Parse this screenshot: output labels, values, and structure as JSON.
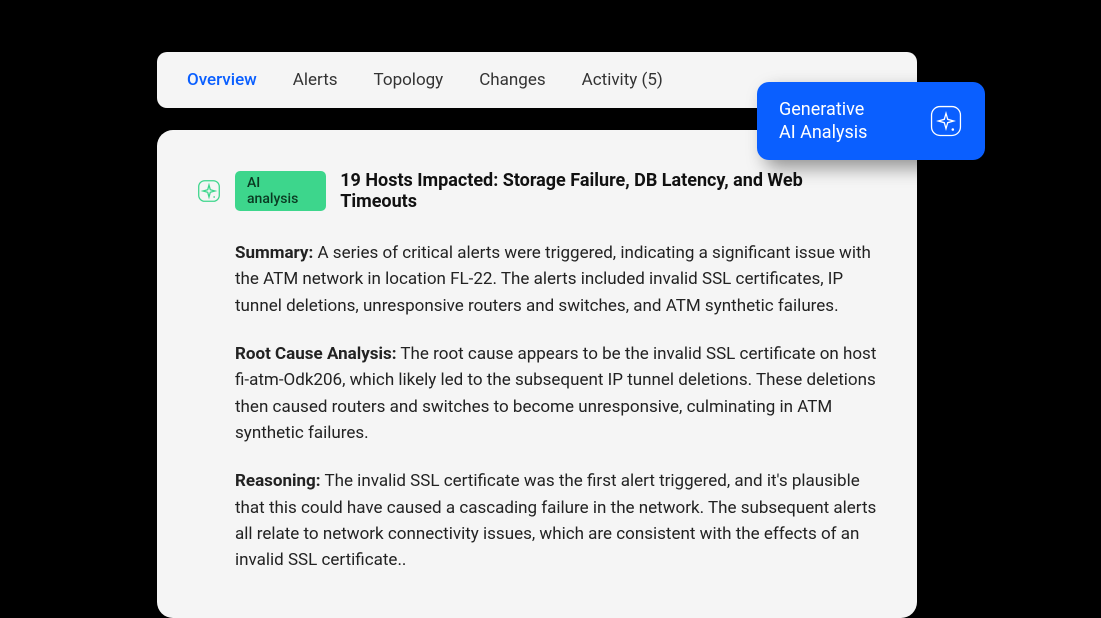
{
  "tabs": [
    {
      "label": "Overview",
      "active": true
    },
    {
      "label": "Alerts",
      "active": false
    },
    {
      "label": "Topology",
      "active": false
    },
    {
      "label": "Changes",
      "active": false
    },
    {
      "label": "Activity (5)",
      "active": false
    }
  ],
  "genAiButton": {
    "line1": "Generative",
    "line2": "AI Analysis"
  },
  "analysis": {
    "badge": "AI analysis",
    "title": "19 Hosts Impacted: Storage Failure, DB Latency, and Web Timeouts",
    "sections": [
      {
        "label": "Summary:",
        "text": " A series of critical alerts were triggered, indicating a significant issue with the ATM network in location FL-22. The alerts included invalid SSL certificates, IP tunnel deletions, unresponsive routers and switches, and ATM synthetic failures."
      },
      {
        "label": "Root Cause Analysis:",
        "text": " The root cause appears to be the invalid SSL certificate on host fi-atm-Odk206, which likely led to the subsequent IP tunnel deletions. These deletions then caused routers and switches to become unresponsive, culminating in ATM synthetic failures."
      },
      {
        "label": "Reasoning:",
        "text": " The invalid SSL certificate was the first alert triggered, and it's plausible that this could have caused a cascading failure in the network. The subsequent alerts all relate to network connectivity issues, which are consistent with the effects of an invalid SSL certificate.."
      }
    ]
  }
}
